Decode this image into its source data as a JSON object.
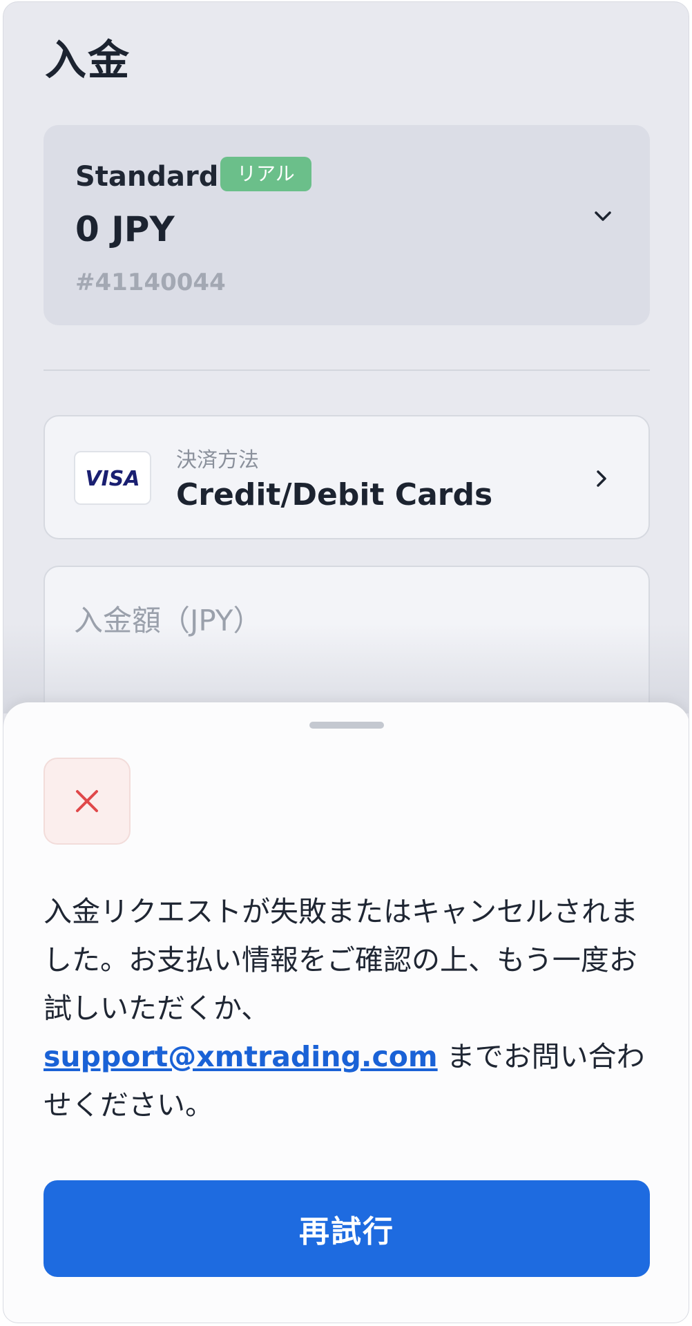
{
  "page": {
    "title": "入金"
  },
  "account": {
    "type": "Standard",
    "badge": "リアル",
    "balance": "0 JPY",
    "number": "#41140044",
    "chevron_icon": "chevron-down-icon"
  },
  "payment": {
    "label": "決済方法",
    "method": "Credit/Debit Cards",
    "logo_text": "VISA",
    "chevron_icon": "chevron-right-icon"
  },
  "amount": {
    "placeholder": "入金額（JPY）"
  },
  "sheet": {
    "error_icon": "close-icon",
    "message_before": "入金リクエストが失敗またはキャンセルされました。お支払い情報をご確認の上、もう一度お試しいただくか、",
    "email": "support@xmtrading.com",
    "message_after": " までお問い合わせください。",
    "retry_label": "再試行"
  },
  "colors": {
    "accent": "#1e6be0",
    "badge": "#6bbf8a",
    "error": "#e0484a",
    "link": "#1a62d6",
    "visa": "#1a1f71"
  }
}
